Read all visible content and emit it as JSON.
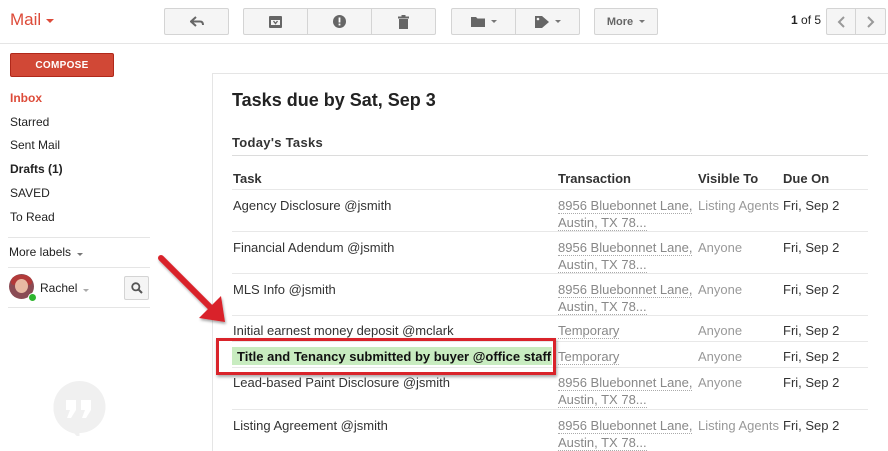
{
  "app": {
    "title": "Mail"
  },
  "toolbar": {
    "more_label": "More"
  },
  "pager": {
    "current": "1",
    "separator": " of ",
    "total": "5"
  },
  "sidebar": {
    "compose_label": "COMPOSE",
    "items": [
      {
        "label": "Inbox",
        "active": true
      },
      {
        "label": "Starred"
      },
      {
        "label": "Sent Mail"
      },
      {
        "label": "Drafts (1)",
        "bold": true
      },
      {
        "label": "SAVED"
      },
      {
        "label": "To Read"
      }
    ],
    "more_labels": "More labels",
    "user_name": "Rachel"
  },
  "email": {
    "subject": "Tasks due by Sat, Sep 3",
    "section_title": "Today's Tasks",
    "columns": [
      "Task",
      "Transaction",
      "Visible To",
      "Due On"
    ],
    "rows": [
      {
        "task": "Agency Disclosure @jsmith",
        "transaction": [
          "8956 Bluebonnet Lane,",
          "Austin, TX 78..."
        ],
        "visible_to": "Listing Agents",
        "due_on": "Fri, Sep 2"
      },
      {
        "task": "Financial Adendum @jsmith",
        "transaction": [
          "8956 Bluebonnet Lane,",
          "Austin, TX 78..."
        ],
        "visible_to": "Anyone",
        "due_on": "Fri, Sep 2"
      },
      {
        "task": "MLS Info @jsmith",
        "transaction": [
          "8956 Bluebonnet Lane,",
          "Austin, TX 78..."
        ],
        "visible_to": "Anyone",
        "due_on": "Fri, Sep 2"
      },
      {
        "task": "Initial earnest money deposit @mclark",
        "transaction": [
          "Temporary"
        ],
        "visible_to": "Anyone",
        "due_on": "Fri, Sep 2"
      },
      {
        "task": "Title and Tenancy submitted by buyer @office staff",
        "transaction": [
          "Temporary"
        ],
        "visible_to": "Anyone",
        "due_on": "Fri, Sep 2",
        "highlighted": true
      },
      {
        "task": "Lead-based Paint Disclosure @jsmith",
        "transaction": [
          "8956 Bluebonnet Lane,",
          "Austin, TX 78..."
        ],
        "visible_to": "Anyone",
        "due_on": "Fri, Sep 2"
      },
      {
        "task": "Listing Agreement @jsmith",
        "transaction": [
          "8956 Bluebonnet Lane,",
          "Austin, TX 78..."
        ],
        "visible_to": "Listing Agents",
        "due_on": "Fri, Sep 2"
      }
    ]
  },
  "colors": {
    "brand": "#dd4b39",
    "compose": "#d14836",
    "annotation": "#d9232a",
    "highlight": "#c8ecc0"
  },
  "icons": [
    "reply-icon",
    "archive-icon",
    "report-spam-icon",
    "trash-icon",
    "folder-icon",
    "label-icon",
    "chevron-left-icon",
    "chevron-right-icon",
    "search-icon",
    "hangouts-icon",
    "annotation-arrow"
  ]
}
